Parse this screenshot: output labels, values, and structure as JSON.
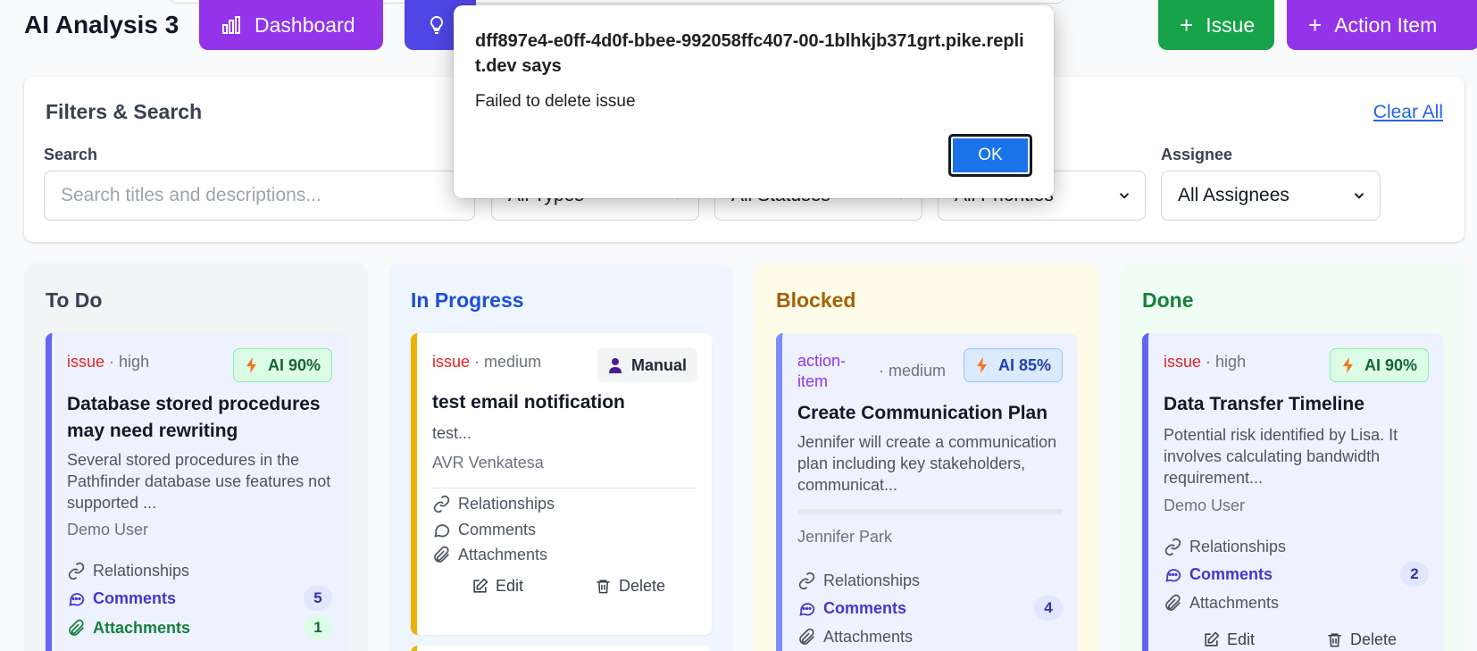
{
  "header": {
    "title": "AI Analysis 3",
    "dashboard_label": "Dashboard",
    "issue_label": "Issue",
    "action_item_label": "Action Item"
  },
  "filters": {
    "title": "Filters & Search",
    "clear_all": "Clear All",
    "search_label": "Search",
    "search_placeholder": "Search titles and descriptions...",
    "type_value": "All Types",
    "status_value": "All Statuses",
    "priority_value": "All Priorities",
    "assignee_label": "Assignee",
    "assignee_value": "All Assignees"
  },
  "columns": {
    "todo": {
      "title": "To Do",
      "card": {
        "type": "issue",
        "priority": "· high",
        "badge": "AI 90%",
        "title": "Database stored procedures may need rewriting",
        "description": "Several stored procedures in the Pathfinder database use features not supported ...",
        "owner": "Demo User",
        "relationships": "Relationships",
        "comments": "Comments",
        "comments_count": "5",
        "attachments": "Attachments",
        "attachments_count": "1"
      }
    },
    "progress": {
      "title": "In Progress",
      "card": {
        "type": "issue",
        "priority": "· medium",
        "badge": "Manual",
        "title": "test email notification",
        "description": "test...",
        "owner": "AVR Venkatesa",
        "relationships": "Relationships",
        "comments": "Comments",
        "attachments": "Attachments",
        "edit": "Edit",
        "delete": "Delete"
      }
    },
    "blocked": {
      "title": "Blocked",
      "card": {
        "type_line1": "action-",
        "type_line2": "item",
        "priority": "· medium",
        "badge": "AI 85%",
        "title": "Create Communication Plan",
        "description": "Jennifer will create a communication plan including key stakeholders, communicat...",
        "owner": "Jennifer Park",
        "relationships": "Relationships",
        "comments": "Comments",
        "comments_count": "4",
        "attachments": "Attachments"
      }
    },
    "done": {
      "title": "Done",
      "card": {
        "type": "issue",
        "priority": "· high",
        "badge": "AI 90%",
        "title": "Data Transfer Timeline",
        "description": "Potential risk identified by Lisa. It involves calculating bandwidth requirement...",
        "owner": "Demo User",
        "relationships": "Relationships",
        "comments": "Comments",
        "comments_count": "2",
        "attachments": "Attachments",
        "edit": "Edit",
        "delete": "Delete"
      }
    }
  },
  "dialog": {
    "origin": "dff897e4-e0ff-4d0f-bbee-992058ffc407-00-1blhkjb371grt.pike.replit.dev says",
    "message": "Failed to delete issue",
    "ok": "OK"
  },
  "colors": {
    "purple": "#9333ea",
    "indigo": "#4f46e5",
    "green": "#16a34a",
    "ok_blue": "#1a73e8"
  }
}
